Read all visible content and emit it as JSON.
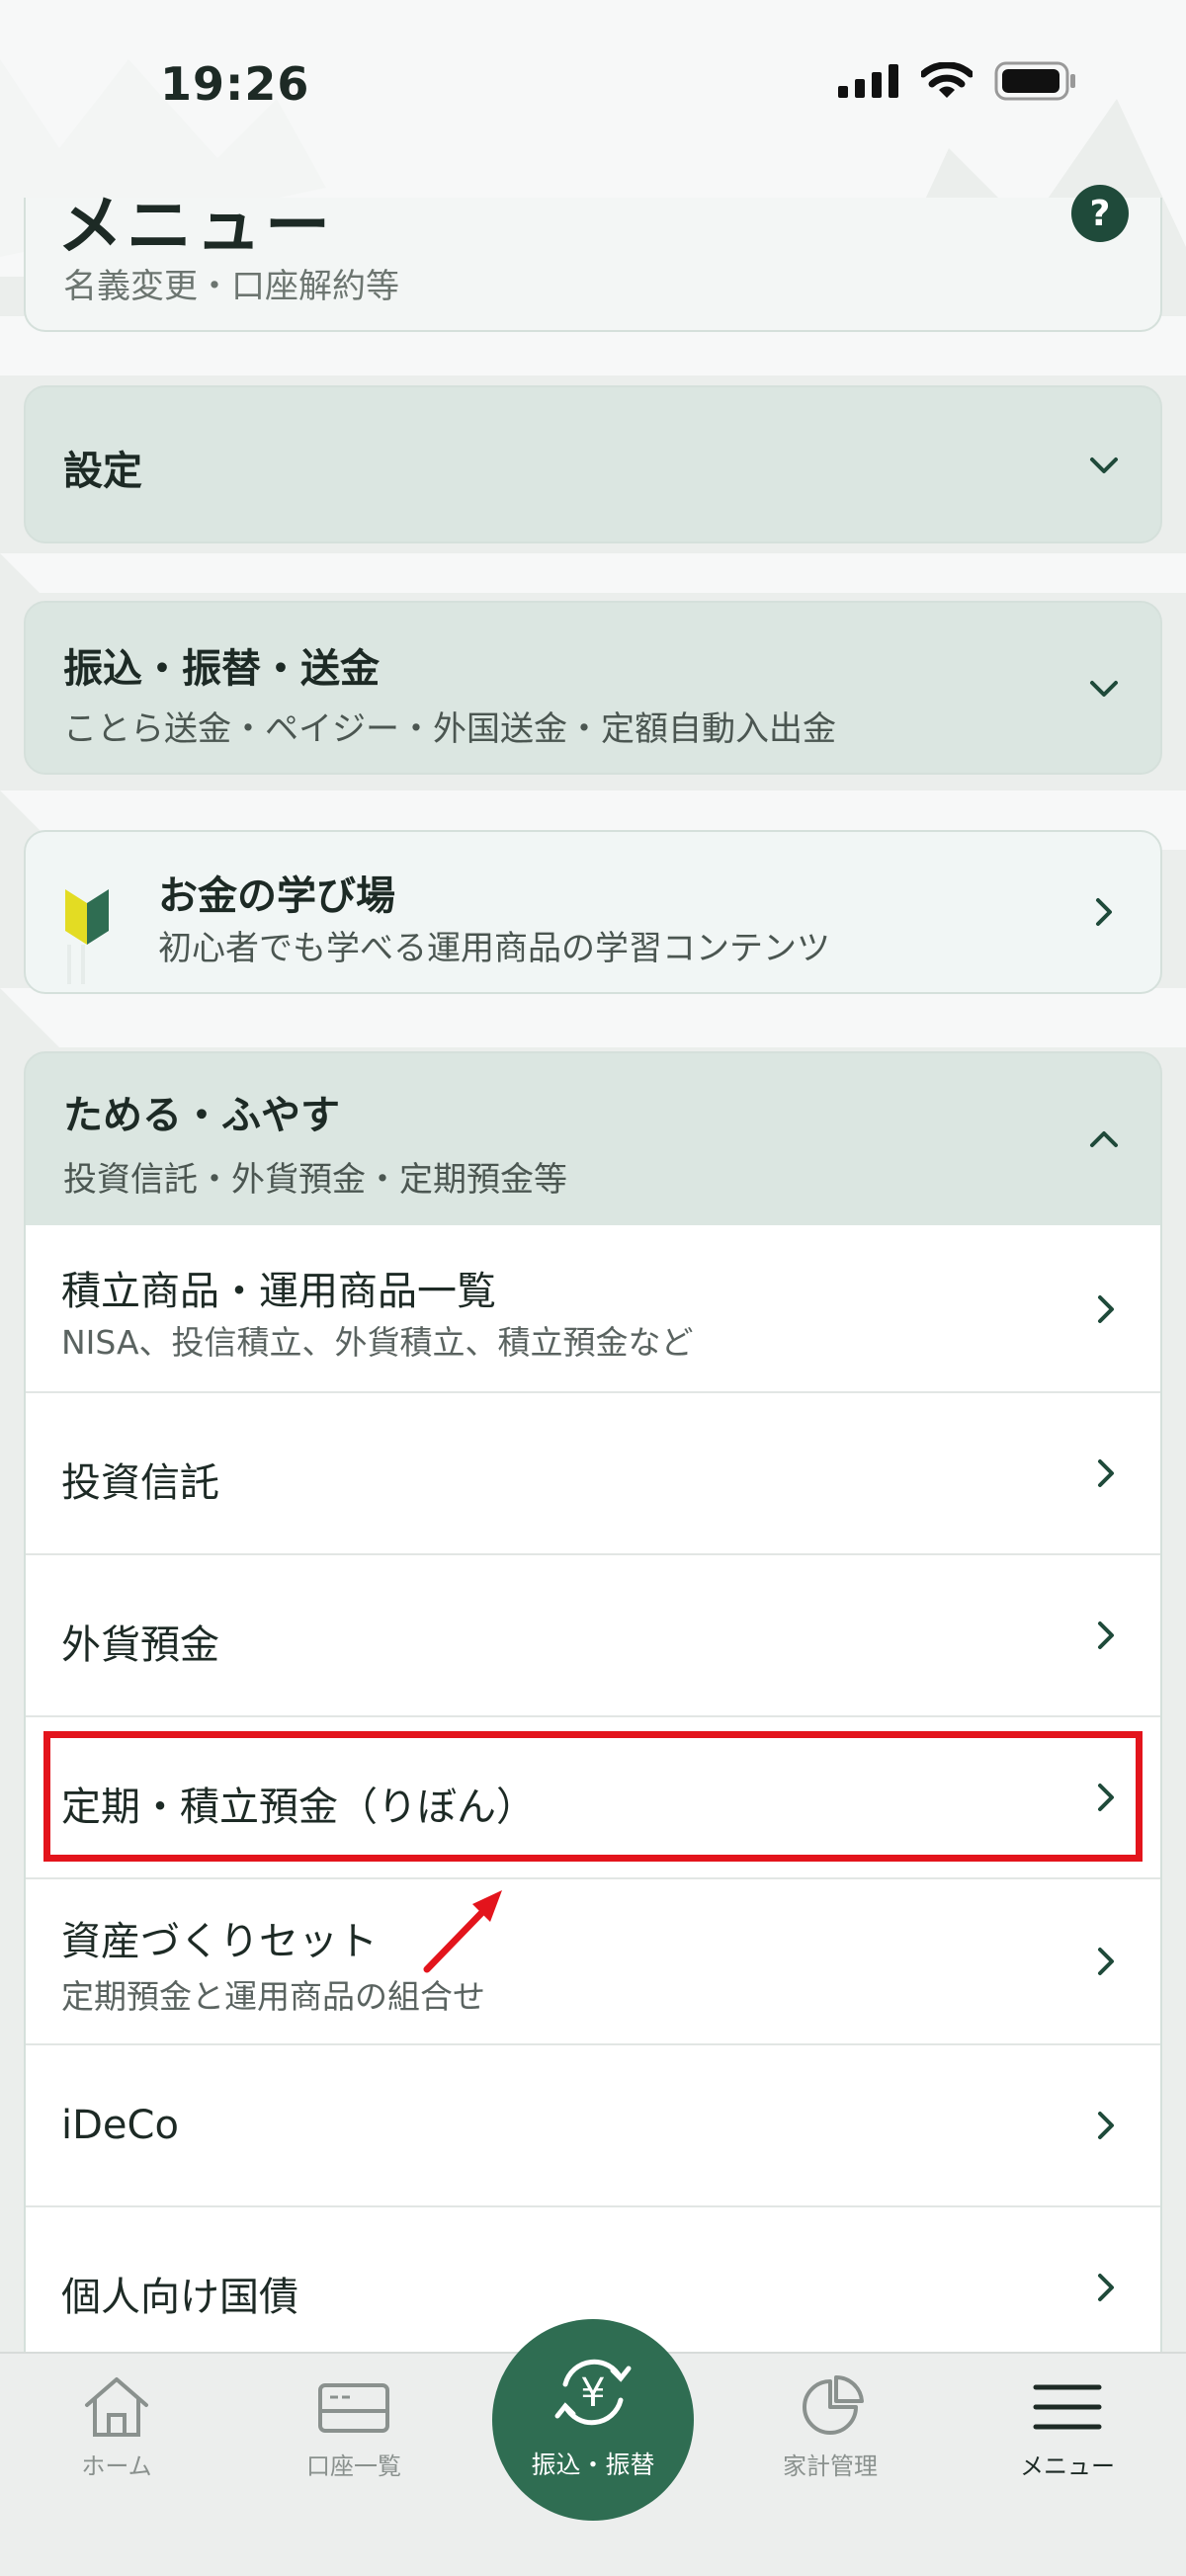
{
  "status_bar": {
    "time": "19:26"
  },
  "header": {
    "title": "メニュー",
    "help": "?"
  },
  "partial_item": {
    "sub": "名義変更・口座解約等"
  },
  "sections": {
    "settings": {
      "title": "設定"
    },
    "transfer": {
      "title": "振込・振替・送金",
      "sub": "ことら送金・ペイジー・外国送金・定額自動入出金"
    },
    "learning": {
      "title": "お金の学び場",
      "sub": "初心者でも学べる運用商品の学習コンテンツ"
    },
    "savings": {
      "title": "ためる・ふやす",
      "sub": "投資信託・外貨預金・定期預金等"
    }
  },
  "savings_items": [
    {
      "label": "積立商品・運用商品一覧",
      "sub": "NISA、投信積立、外貨積立、積立預金など"
    },
    {
      "label": "投資信託"
    },
    {
      "label": "外貨預金"
    },
    {
      "label": "定期・積立預金（りぼん）"
    },
    {
      "label": "資産づくりセット",
      "sub": "定期預金と運用商品の組合せ"
    },
    {
      "label": "iDeCo"
    },
    {
      "label": "個人向け国債"
    }
  ],
  "tabs": {
    "home": "ホーム",
    "accounts": "口座一覧",
    "transfer": "振込・振替",
    "budget": "家計管理",
    "menu": "メニュー"
  },
  "colors": {
    "brand": "#2f6d52",
    "highlight": "#e3141c",
    "section_bg": "#dbe6e1"
  }
}
